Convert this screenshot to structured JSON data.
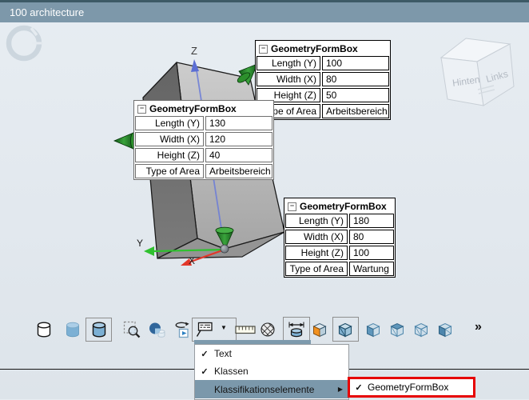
{
  "window": {
    "title": "100 architecture"
  },
  "glyphs": {
    "minus": "−",
    "check": "✓",
    "submenu_arrow": "▶",
    "dropdown_arrow": "▼",
    "overflow": "»"
  },
  "axes": {
    "x": "X",
    "y": "Y",
    "z": "Z"
  },
  "nav_cube": {
    "left_face": "Hinten",
    "right_face": "Links"
  },
  "tables": [
    {
      "title": "GeometryFormBox",
      "rows": [
        {
          "label": "Length (Y)",
          "value": "100"
        },
        {
          "label": "Width (X)",
          "value": "80"
        },
        {
          "label": "Height (Z)",
          "value": "50"
        },
        {
          "label": "Type of Area",
          "value": "Arbeitsbereich"
        }
      ]
    },
    {
      "title": "GeometryFormBox",
      "rows": [
        {
          "label": "Length (Y)",
          "value": "130"
        },
        {
          "label": "Width (X)",
          "value": "120"
        },
        {
          "label": "Height (Z)",
          "value": "40"
        },
        {
          "label": "Type of Area",
          "value": "Arbeitsbereich"
        }
      ]
    },
    {
      "title": "GeometryFormBox",
      "rows": [
        {
          "label": "Length (Y)",
          "value": "180"
        },
        {
          "label": "Width (X)",
          "value": "80"
        },
        {
          "label": "Height (Z)",
          "value": "100"
        },
        {
          "label": "Type of Area",
          "value": "Wartung"
        }
      ]
    }
  ],
  "toolbar": {
    "buttons": [
      {
        "icon": "cylinder-wireframe",
        "pressed": false
      },
      {
        "icon": "cylinder-shaded",
        "pressed": false
      },
      {
        "icon": "cylinder-outlined",
        "pressed": true
      },
      {
        "icon": "zoom-window",
        "pressed": false
      },
      {
        "icon": "sphere-overlap",
        "pressed": false
      },
      {
        "icon": "rotate-animation",
        "pressed": false
      },
      {
        "icon": "annotation-label-dropdown",
        "pressed": true,
        "open": true
      },
      {
        "icon": "ruler-measure",
        "pressed": false
      },
      {
        "icon": "hatched-sphere",
        "pressed": false
      },
      {
        "icon": "cylinder-dimension",
        "pressed": true
      },
      {
        "icon": "cube-orange-face",
        "pressed": false
      },
      {
        "icon": "cube-solid-blue",
        "pressed": true
      },
      {
        "icon": "cube-front-face",
        "pressed": false
      },
      {
        "icon": "cube-top-face",
        "pressed": false
      },
      {
        "icon": "cube-wireframe",
        "pressed": false
      },
      {
        "icon": "cube-left-face",
        "pressed": false
      }
    ]
  },
  "menu": {
    "items": [
      {
        "label": "Text",
        "checked": true,
        "highlighted": false
      },
      {
        "label": "Klassen",
        "checked": true,
        "highlighted": false
      },
      {
        "label": "Klassifikationselemente",
        "checked": false,
        "highlighted": true,
        "has_submenu": true
      }
    ]
  },
  "submenu": {
    "items": [
      {
        "label": "GeometryFormBox",
        "checked": true,
        "outlined": true
      }
    ]
  },
  "colors": {
    "titlebar": "#7d98aa",
    "menu_highlight": "#7b98ab",
    "submenu_outline": "#e60000",
    "axis_x": "#e2372a",
    "axis_y": "#2fc12f",
    "axis_z": "#6b7cd8",
    "handle_green": "#2f9e2f",
    "toolbar_blue": "#7cb0d4",
    "orange_face": "#f2911f"
  }
}
